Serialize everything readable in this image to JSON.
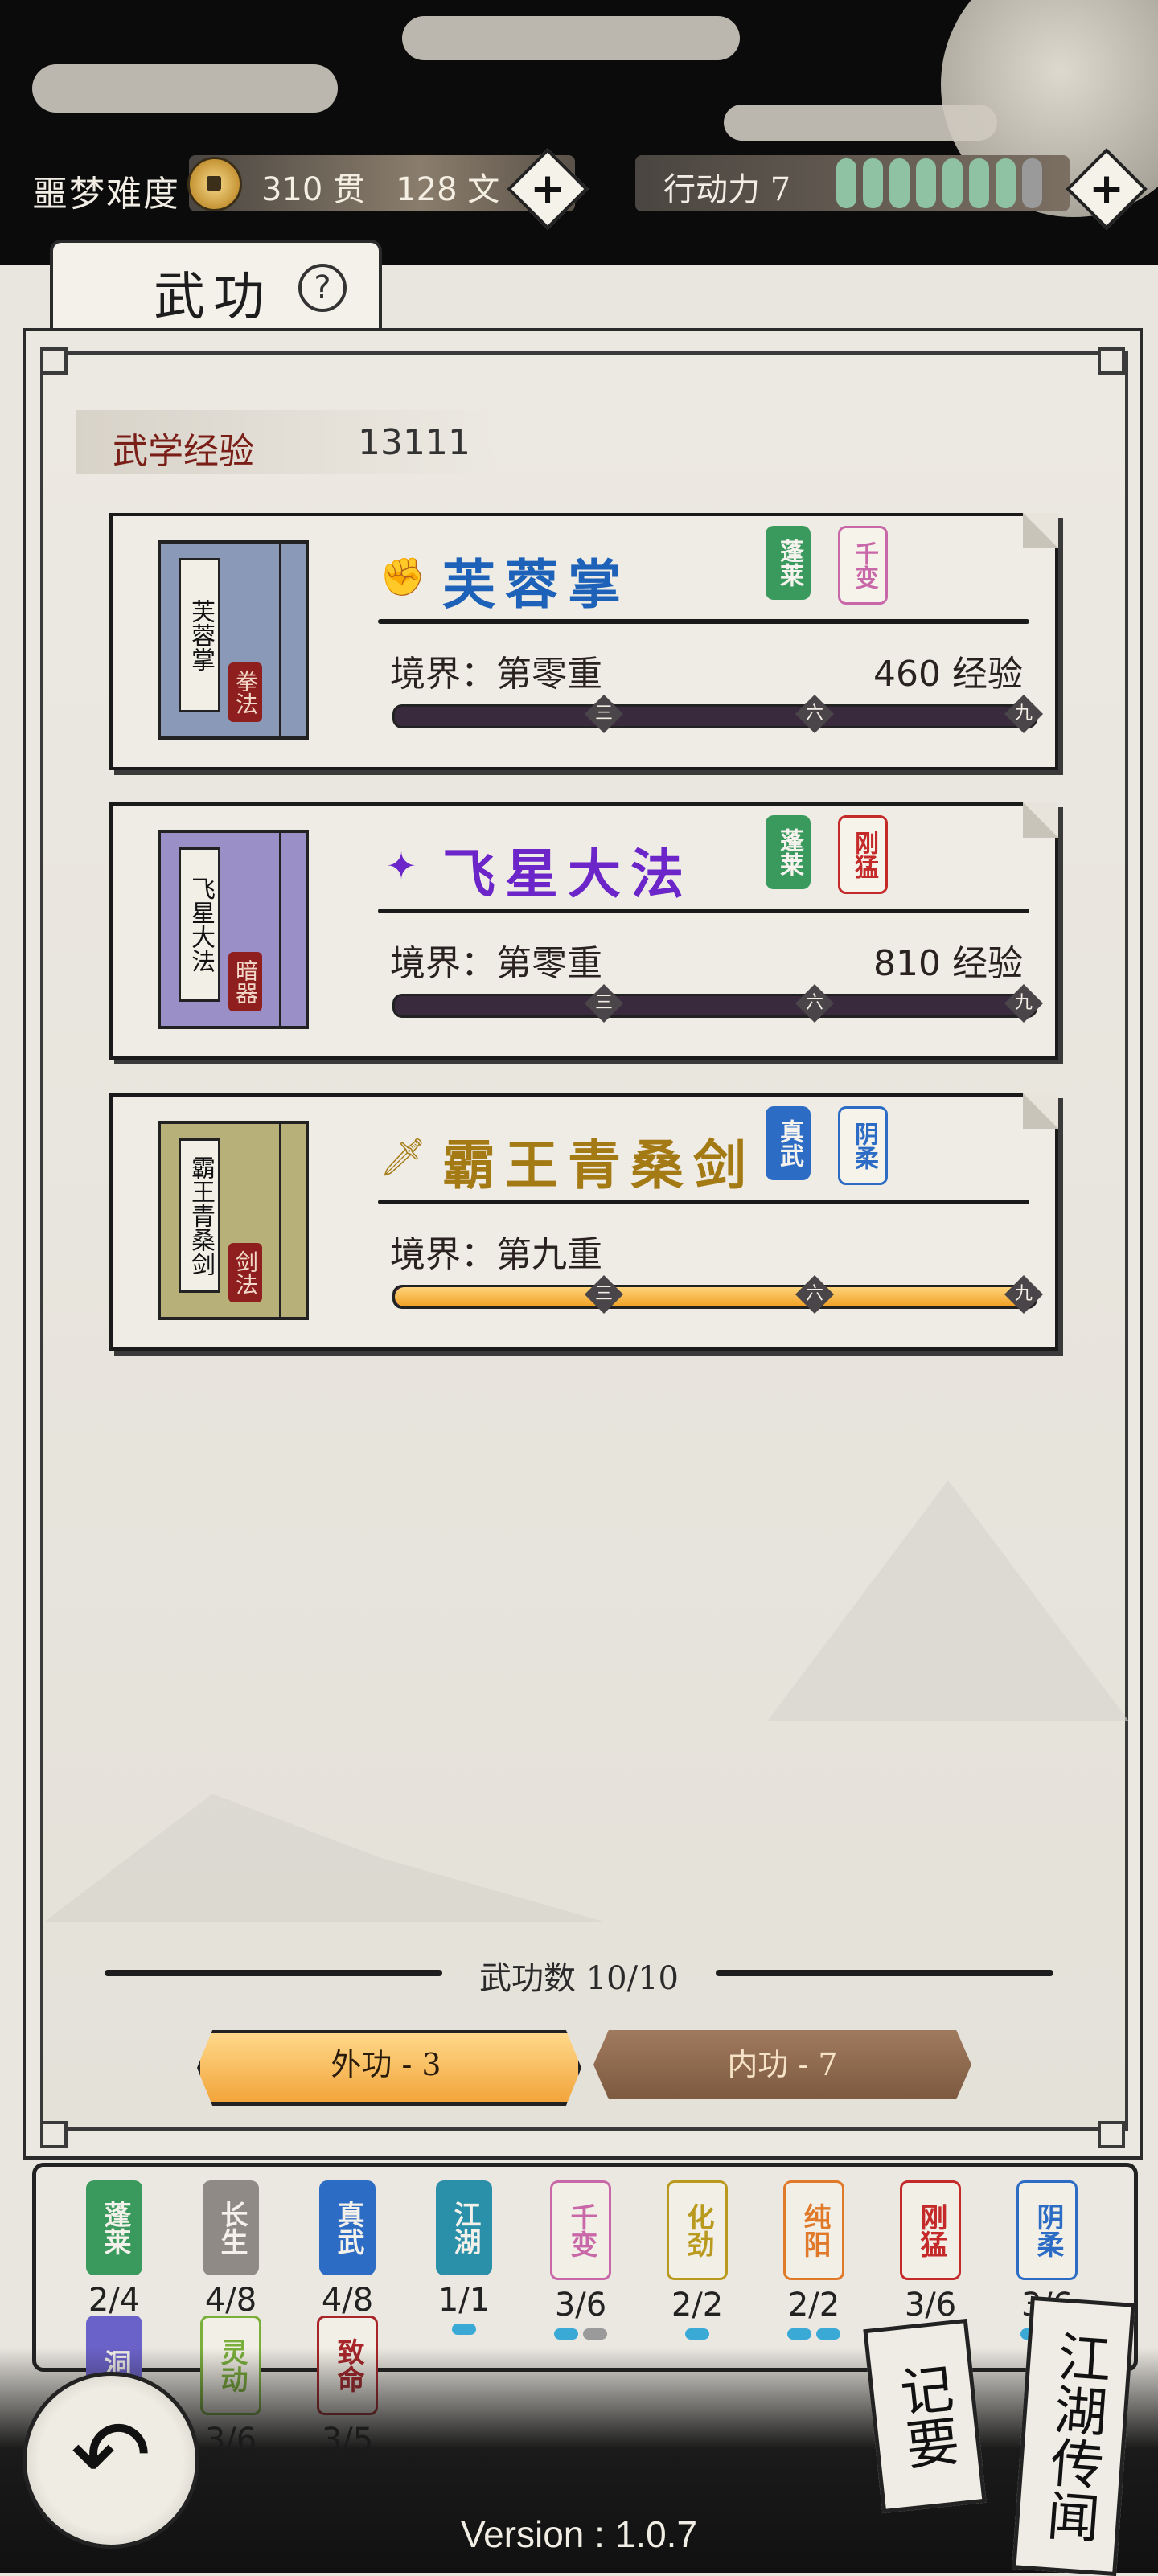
{
  "topbar": {
    "difficulty": "噩梦难度",
    "money_guan": "310 贯",
    "money_wen": "128 文",
    "stamina_label": "行动力 7",
    "stamina_value": 7,
    "stamina_max": 8,
    "plus": "+"
  },
  "tab": {
    "title": "武功",
    "help": "?"
  },
  "exp": {
    "label": "武学经验",
    "value": "13111"
  },
  "skills": [
    {
      "name": "芙蓉掌",
      "book_title": "芙蓉掌",
      "book_type": "拳法",
      "realm": "境界：第零重",
      "exp": "460 经验",
      "icon": "fist-icon",
      "color": "#1d62b8",
      "progress": 0,
      "badges": [
        {
          "text": "蓬莱",
          "color": "#3a9a5e",
          "style": "fill"
        },
        {
          "text": "千变",
          "color": "#c968a8",
          "style": "line"
        }
      ]
    },
    {
      "name": "飞星大法",
      "book_title": "飞星大法",
      "book_type": "暗器",
      "realm": "境界：第零重",
      "exp": "810 经验",
      "icon": "dart-icon",
      "color": "#6b25c9",
      "progress": 0,
      "badges": [
        {
          "text": "蓬莱",
          "color": "#3a9a5e",
          "style": "fill"
        },
        {
          "text": "刚猛",
          "color": "#c52a2a",
          "style": "line"
        }
      ]
    },
    {
      "name": "霸王青桑剑",
      "book_title": "霸王青桑剑",
      "book_type": "剑法",
      "realm": "境界：第九重",
      "exp": "",
      "icon": "sword-icon",
      "color": "#a47a14",
      "progress": 1,
      "badges": [
        {
          "text": "真武",
          "color": "#2c6cc4",
          "style": "fill"
        },
        {
          "text": "阴柔",
          "color": "#2c6cc4",
          "style": "line"
        }
      ]
    }
  ],
  "ticks": [
    "三",
    "六",
    "九"
  ],
  "count": "武功数 10/10",
  "filters": {
    "outer": "外功 - 3",
    "inner": "内功 - 7"
  },
  "talents": [
    {
      "text": "蓬莱",
      "count": "2/4",
      "color": "#3a9a5e",
      "style": "fill",
      "pips": []
    },
    {
      "text": "长生",
      "count": "4/8",
      "color": "#8f8a86",
      "style": "fill",
      "pips": []
    },
    {
      "text": "真武",
      "count": "4/8",
      "color": "#2c6cc4",
      "style": "fill",
      "pips": []
    },
    {
      "text": "江湖",
      "count": "1/1",
      "color": "#2a8fa8",
      "style": "fill",
      "pips": [
        1
      ]
    },
    {
      "text": "千变",
      "count": "3/6",
      "color": "#c968a8",
      "style": "line",
      "pips": [
        1,
        0
      ]
    },
    {
      "text": "化劲",
      "count": "2/2",
      "color": "#b99a1e",
      "style": "line",
      "pips": [
        1
      ]
    },
    {
      "text": "纯阳",
      "count": "2/2",
      "color": "#e07a2a",
      "style": "line",
      "pips": [
        1,
        1
      ]
    },
    {
      "text": "刚猛",
      "count": "3/6",
      "color": "#c52a2a",
      "style": "line",
      "pips": []
    },
    {
      "text": "阴柔",
      "count": "3/6",
      "color": "#2c6cc4",
      "style": "line",
      "pips": [
        1,
        0
      ]
    },
    {
      "text": "洞",
      "count": "",
      "color": "#6b62c9",
      "style": "fill",
      "pips": []
    },
    {
      "text": "灵动",
      "count": "3/6",
      "color": "#7ab03a",
      "style": "line",
      "pips": []
    },
    {
      "text": "致命",
      "count": "3/5",
      "color": "#a8252a",
      "style": "line",
      "pips": []
    }
  ],
  "bottom": {
    "back": "↶",
    "notes": "记要",
    "rumors": "江湖传闻",
    "version": "Version : 1.0.7"
  }
}
